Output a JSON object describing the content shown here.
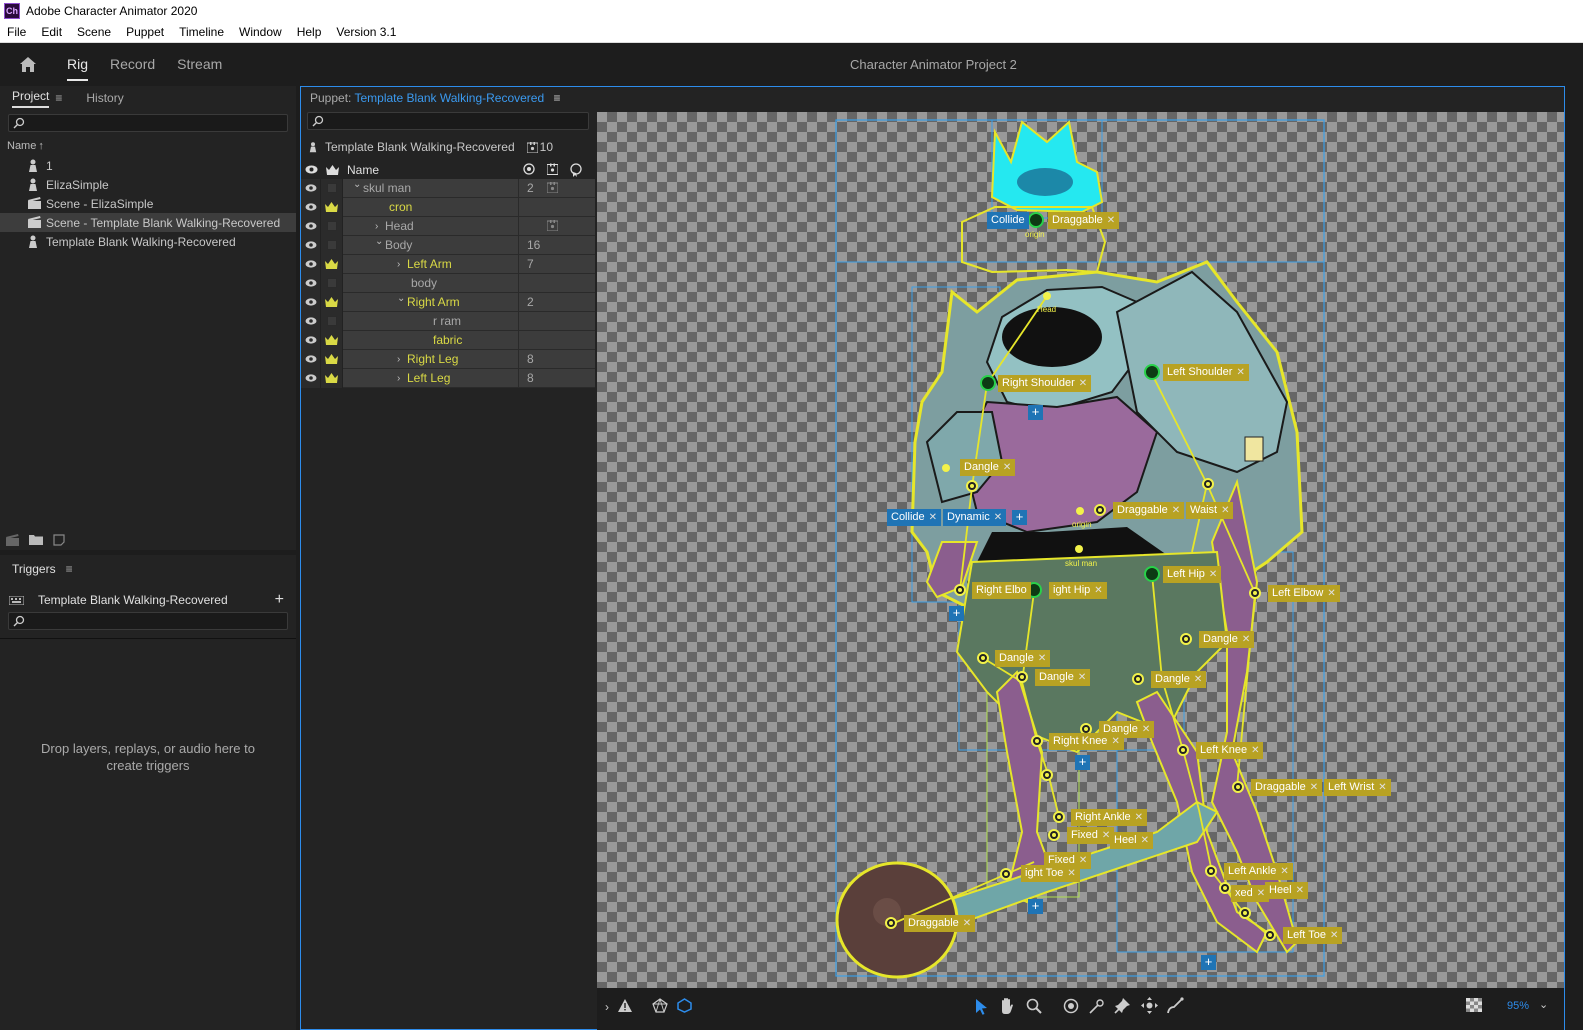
{
  "window": {
    "title": "Adobe Character Animator 2020",
    "app_icon": "Ch"
  },
  "menu": [
    "File",
    "Edit",
    "Scene",
    "Puppet",
    "Timeline",
    "Window",
    "Help",
    "Version 3.1"
  ],
  "workspace": {
    "tabs": [
      "Rig",
      "Record",
      "Stream"
    ],
    "active": "Rig",
    "project_title": "Character Animator Project 2"
  },
  "project_panel": {
    "tabs": [
      "Project",
      "History"
    ],
    "column": "Name",
    "items": [
      {
        "label": "1",
        "icon": "puppet-icon"
      },
      {
        "label": "ElizaSimple",
        "icon": "puppet-icon"
      },
      {
        "label": "Scene - ElizaSimple",
        "icon": "scene-icon"
      },
      {
        "label": "Scene - Template Blank Walking-Recovered",
        "icon": "scene-icon",
        "selected": true
      },
      {
        "label": "Template Blank Walking-Recovered",
        "icon": "puppet-icon"
      }
    ]
  },
  "triggers_panel": {
    "title": "Triggers",
    "puppet": "Template Blank Walking-Recovered",
    "drop_hint": "Drop layers, replays, or audio here to create triggers"
  },
  "puppet_panel": {
    "label": "Puppet:",
    "name": "Template Blank Walking-Recovered",
    "header_name": "Template Blank Walking-Recovered",
    "header_count": "10",
    "column_name": "Name",
    "layers": [
      {
        "name": "skul man",
        "indent": 0,
        "expander": "open",
        "count": "2",
        "crown": false,
        "yellow": false
      },
      {
        "name": "cron",
        "indent": 1,
        "expander": "",
        "count": "",
        "crown": true,
        "yellow": true
      },
      {
        "name": "Head",
        "indent": 1,
        "expander": "closed",
        "count": "",
        "crown": false,
        "yellow": false
      },
      {
        "name": "Body",
        "indent": 1,
        "expander": "open",
        "count": "16",
        "crown": false,
        "yellow": false
      },
      {
        "name": "Left Arm",
        "indent": 2,
        "expander": "closed",
        "count": "7",
        "crown": true,
        "yellow": true
      },
      {
        "name": "body",
        "indent": 2,
        "expander": "",
        "count": "",
        "crown": false,
        "yellow": false
      },
      {
        "name": "Right Arm",
        "indent": 2,
        "expander": "open",
        "count": "2",
        "crown": true,
        "yellow": true
      },
      {
        "name": "r ram",
        "indent": 3,
        "expander": "",
        "count": "",
        "crown": false,
        "yellow": false
      },
      {
        "name": "fabric",
        "indent": 3,
        "expander": "",
        "count": "",
        "crown": true,
        "yellow": true
      },
      {
        "name": "Right Leg",
        "indent": 2,
        "expander": "closed",
        "count": "8",
        "crown": true,
        "yellow": true
      },
      {
        "name": "Left Leg",
        "indent": 2,
        "expander": "closed",
        "count": "8",
        "crown": true,
        "yellow": true
      }
    ]
  },
  "canvas_tags": {
    "collide_top": "Collide",
    "draggable_top": "Draggable",
    "origin_top": "origin",
    "head": "Head",
    "right_shoulder": "Right Shoulder",
    "left_shoulder": "Left Shoulder",
    "dangle_1": "Dangle",
    "collide_mid": "Collide",
    "dynamic": "Dynamic",
    "draggable_mid": "Draggable",
    "waist": "Waist",
    "origin_mid": "origin",
    "right_elbow": "Right Elbo",
    "right_hip": "ight Hip",
    "left_hip": "Left Hip",
    "left_elbow": "Left Elbow",
    "dangle_2": "Dangle",
    "dangle_3": "Dangle",
    "dangle_4": "Dangle",
    "dangle_5": "Dangle",
    "dangle_6": "Dangle",
    "right_knee": "Right Knee",
    "left_knee": "Left Knee",
    "draggable_wrist": "Draggable",
    "left_wrist": "Left Wrist",
    "right_ankle": "Right Ankle",
    "fixed_1": "Fixed",
    "heel_1": "Heel",
    "fixed_2": "Fixed",
    "right_toe": "ight Toe",
    "left_ankle": "Left Ankle",
    "fixed_3": "xed",
    "heel_2": "Heel",
    "draggable_ball": "Draggable",
    "left_toe": "Left Toe",
    "skul_man": "skul man"
  },
  "zoom": "95%"
}
